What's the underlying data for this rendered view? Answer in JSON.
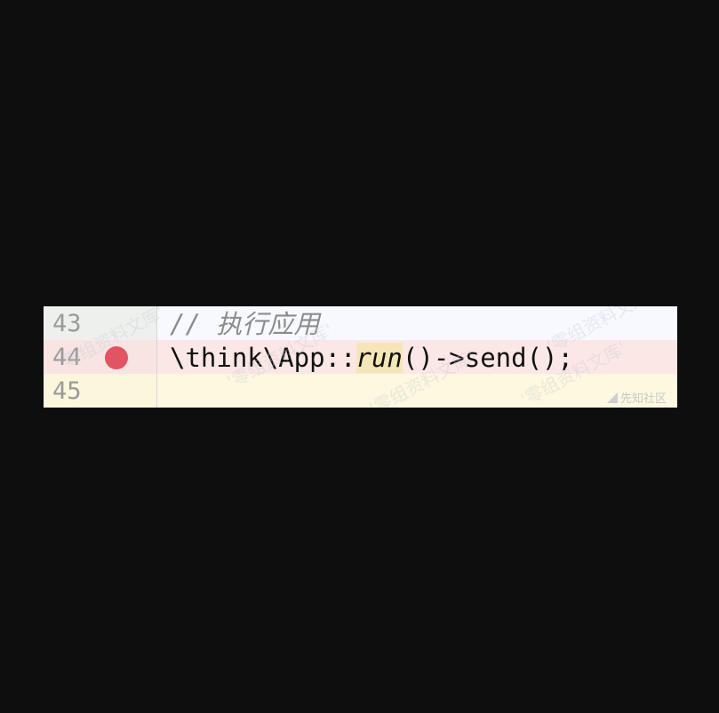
{
  "editor": {
    "lines": [
      {
        "number": "43",
        "code_comment": "// 执行应用",
        "has_breakpoint": false
      },
      {
        "number": "44",
        "code_prefix": "\\think\\App::",
        "code_fn": "run",
        "code_suffix": "()->send();",
        "has_breakpoint": true
      },
      {
        "number": "45",
        "code": "",
        "has_breakpoint": false
      }
    ],
    "breakpoint_color": "#e05561",
    "breakpoint_icon": "breakpoint-dot-icon"
  },
  "watermark": {
    "text": "'零组资料文库'",
    "logo_text": "先知社区"
  }
}
